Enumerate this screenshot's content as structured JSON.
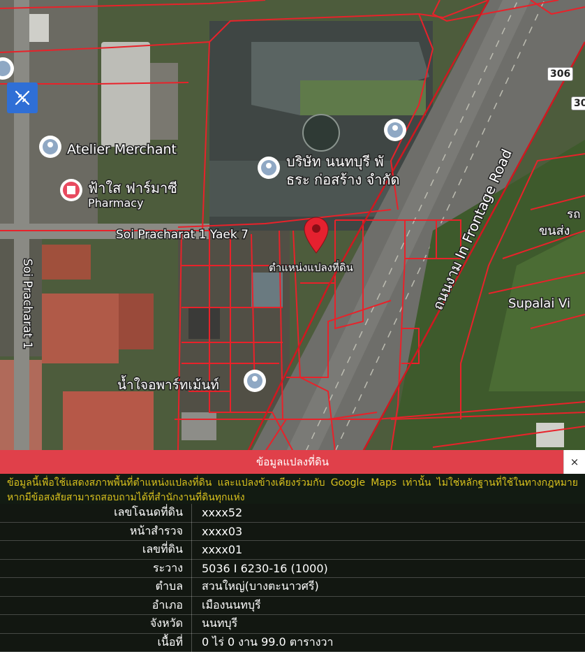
{
  "map": {
    "places": [
      {
        "name": "Atelier Merchant"
      },
      {
        "name": "ฟ้าใส ฟาร์มาซี"
      },
      {
        "name": "Pharmacy"
      },
      {
        "name": "บริษัท นนทบุรี พั"
      },
      {
        "name": "ธระ ก่อสร้าง จำกัด"
      },
      {
        "name": "Soi Pracharat 1 Yaek 7"
      },
      {
        "name": "Soi Pracharat 1"
      },
      {
        "name": "ตำแหน่งแปลงที่ดิน"
      },
      {
        "name": "ถนนงาม In Frontage Road"
      },
      {
        "name": "Supalai Vi"
      },
      {
        "name": "รถ"
      },
      {
        "name": "ขนส่ง"
      },
      {
        "name": "น้ำใจอพาร์ทเม้นท์"
      }
    ],
    "shields": [
      "306",
      "30"
    ],
    "tool_button_icon": "ruler-pencil-icon"
  },
  "panel": {
    "title": "ข้อมูลแปลงที่ดิน",
    "close_label": "×",
    "notice": "ข้อมูลนี้เพื่อใช้แสดงสภาพพื้นที่ตำแหน่งแปลงที่ดิน และแปลงข้างเคียงร่วมกับ Google Maps เท่านั้น ไม่ใช่หลักฐานที่ใช้ในทางกฎหมาย หากมีข้อสงสัยสามารถสอบถามได้ที่สำนักงานที่ดินทุกแห่ง",
    "rows": [
      {
        "label": "เลขโฉนดที่ดิน",
        "value": "xxxx52"
      },
      {
        "label": "หน้าสำรวจ",
        "value": "xxxx03"
      },
      {
        "label": "เลขที่ดิน",
        "value": "xxxx01"
      },
      {
        "label": "ระวาง",
        "value": "5036 I 6230-16 (1000)"
      },
      {
        "label": "ตำบล",
        "value": "สวนใหญ่(บางตะนาวศรี)"
      },
      {
        "label": "อำเภอ",
        "value": "เมืองนนทบุรี"
      },
      {
        "label": "จังหวัด",
        "value": "นนทบุรี"
      },
      {
        "label": "เนื้อที่",
        "value": "0 ไร่ 0 งาน 99.0 ตารางวา"
      }
    ]
  },
  "colors": {
    "parcel_line": "#e8222a",
    "header_bg": "#e0404a",
    "notice_text": "#d9c21e",
    "tool_button": "#2f6fd6"
  }
}
